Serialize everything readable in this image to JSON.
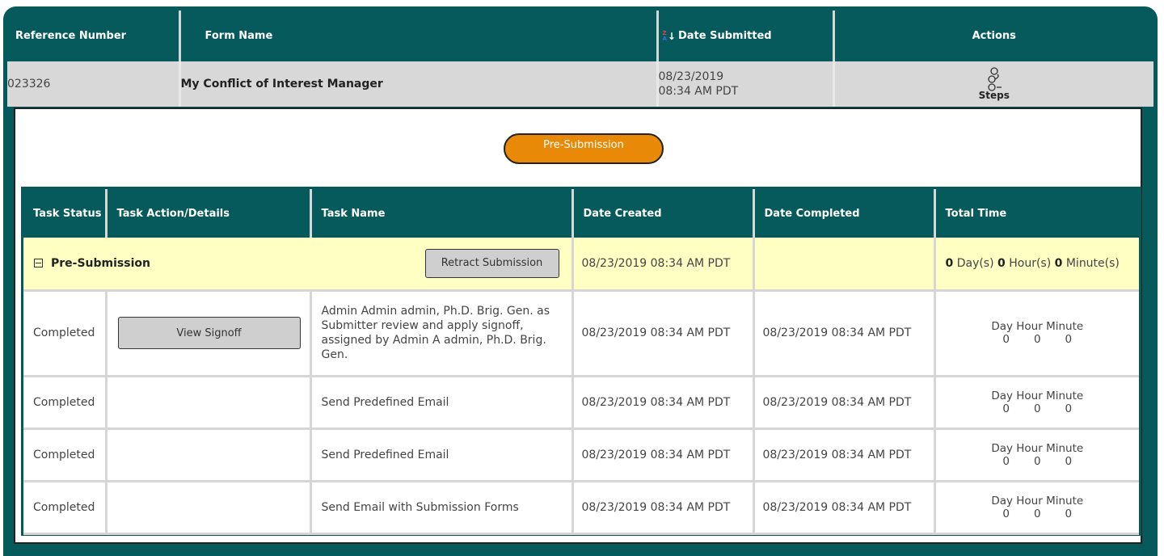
{
  "outer_headers": {
    "reference_number": "Reference Number",
    "form_name": "Form Name",
    "date_submitted": "Date Submitted",
    "actions": "Actions"
  },
  "sort_icon": {
    "name": "sort-za-icon",
    "z": "Z",
    "a": "A",
    "arrow": "↓"
  },
  "submission": {
    "reference_number": "023326",
    "form_name": "My Conflict of Interest Manager",
    "date_line1": "08/23/2019",
    "date_line2": "08:34 AM PDT",
    "steps_label": "Steps",
    "steps_icon": "steps-icon"
  },
  "stage_button": "Pre-Submission",
  "task_headers": {
    "status": "Task Status",
    "action": "Task Action/Details",
    "name": "Task Name",
    "created": "Date Created",
    "completed": "Date Completed",
    "total": "Total Time"
  },
  "group": {
    "label": "Pre-Submission",
    "retract_button": "Retract Submission",
    "date_created": "08/23/2019 08:34 AM PDT",
    "date_completed": "",
    "days": "0",
    "days_unit": "Day(s)",
    "hours": "0",
    "hours_unit": "Hour(s)",
    "minutes": "0",
    "minutes_unit": "Minute(s)"
  },
  "time_header": "Day Hour Minute",
  "tasks": [
    {
      "status": "Completed",
      "action_button": "View Signoff",
      "name": "Admin Admin admin, Ph.D. Brig. Gen. as Submitter review and apply signoff, assigned by Admin A admin, Ph.D. Brig. Gen.",
      "date_created": "08/23/2019 08:34 AM PDT",
      "date_completed": "08/23/2019 08:34 AM PDT",
      "day": "0",
      "hour": "0",
      "minute": "0"
    },
    {
      "status": "Completed",
      "action_button": "",
      "name": "Send Predefined Email",
      "date_created": "08/23/2019 08:34 AM PDT",
      "date_completed": "08/23/2019 08:34 AM PDT",
      "day": "0",
      "hour": "0",
      "minute": "0"
    },
    {
      "status": "Completed",
      "action_button": "",
      "name": "Send Predefined Email",
      "date_created": "08/23/2019 08:34 AM PDT",
      "date_completed": "08/23/2019 08:34 AM PDT",
      "day": "0",
      "hour": "0",
      "minute": "0"
    },
    {
      "status": "Completed",
      "action_button": "",
      "name": "Send Email with Submission Forms",
      "date_created": "08/23/2019 08:34 AM PDT",
      "date_completed": "08/23/2019 08:34 AM PDT",
      "day": "0",
      "hour": "0",
      "minute": "0"
    }
  ],
  "colors": {
    "header_teal": "#065a5b",
    "stage_orange": "#e88a07",
    "group_yellow": "#ffffc4",
    "row_gray": "#d8d8d8"
  }
}
